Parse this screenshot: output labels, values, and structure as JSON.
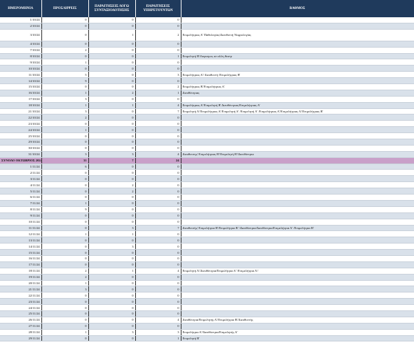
{
  "headers": [
    "ΗΜΕΡΟΜΗΝΙΑ",
    "ΠΡΟΣΛΗΨΕΙΣ",
    "ΠΑΡΑΙΤΗΣΕΙΣ ΛΟΓΩ ΣΥΝΤΑΞΙΟΔΟΤΗΣΗΣ",
    "ΠΑΡΑΙΤΗΣΕΙΣ ΥΠΗΡΕΤΟΥΝΤΩΝ",
    "ΒΑΘΜΟΣ"
  ],
  "rows": [
    {
      "date": "1/10/24",
      "p": "0",
      "s": "0",
      "r": "0",
      "rank": ""
    },
    {
      "date": "2/10/24",
      "p": "0",
      "s": "0",
      "r": "0",
      "rank": ""
    },
    {
      "date": "3/10/24",
      "p": "0",
      "s": "1",
      "r": "2",
      "rank": "Επιμελήτριας Α' Παθολογίας/Διευθυντή Νεφρολογίας",
      "tall": true
    },
    {
      "date": "4/10/24",
      "p": "0",
      "s": "0",
      "r": "0",
      "rank": ""
    },
    {
      "date": "7/10/24",
      "p": "2",
      "s": "0",
      "r": "0",
      "rank": ""
    },
    {
      "date": "8/10/24",
      "p": "0",
      "s": "0",
      "r": "1",
      "rank": "Επιμελητή Β'/διορισμος σε αλλη θεσηr"
    },
    {
      "date": "9/10/24",
      "p": "1",
      "s": "0",
      "r": "0",
      "rank": ""
    },
    {
      "date": "10/10/24",
      "p": "0",
      "s": "0",
      "r": "0",
      "rank": ""
    },
    {
      "date": "11/10/24",
      "p": "5",
      "s": "0",
      "r": "3",
      "rank": "Επιμελήτριας Α'/ Διευθυντή /Επιμελήτριας Β'"
    },
    {
      "date": "14/10/24",
      "p": "9",
      "s": "0",
      "r": "0",
      "rank": ""
    },
    {
      "date": "15/10/24",
      "p": "0",
      "s": "0",
      "r": "2",
      "rank": "Επιμελήτριας Β'/Επιμελήτριας Α'"
    },
    {
      "date": "16/10/24",
      "p": "1",
      "s": "2",
      "r": "1",
      "rank": "Διευθύντριας"
    },
    {
      "date": "17/10/24",
      "p": "3",
      "s": "0",
      "r": "0",
      "rank": ""
    },
    {
      "date": "18/10/24",
      "p": "1",
      "s": "1",
      "r": "4",
      "rank": "Επιμελήτριας Α'/Επιμελητή Β' Διευθύντριας/Επιμελήτριας Α'"
    },
    {
      "date": "21/10/24",
      "p": "3",
      "s": "0",
      "r": "7",
      "rank": "Επιμελητή Α'/Επιμελήτριας Α'/Επιμελητή Α' /Επιμελητή Α' /Επιμελήτριας Α'/Επιμελήτριας Α'/Επιμελήτριας Β'"
    },
    {
      "date": "22/10/24",
      "p": "2",
      "s": "0",
      "r": "0",
      "rank": ""
    },
    {
      "date": "23/10/24",
      "p": "0",
      "s": "0",
      "r": "0",
      "rank": ""
    },
    {
      "date": "24/10/24",
      "p": "1",
      "s": "0",
      "r": "0",
      "rank": ""
    },
    {
      "date": "25/10/24",
      "p": "0",
      "s": "0",
      "r": "0",
      "rank": ""
    },
    {
      "date": "29/10/24",
      "p": "0",
      "s": "0",
      "r": "0",
      "rank": ""
    },
    {
      "date": "30/10/24",
      "p": "0",
      "s": "0",
      "r": "0",
      "rank": ""
    },
    {
      "date": "31/10/24",
      "p": "3",
      "s": "3",
      "r": "4",
      "rank": "Διευθυντης/ Επιμελήτριας Β'/Επιμελητή Β'/Διευθύντρια"
    },
    {
      "date": "ΣΥΝΟΛΟ ΟΚΤΩΒΡΙΟΣ 2024",
      "p": "31",
      "s": "7",
      "r": "24",
      "rank": "",
      "total": true
    },
    {
      "date": "1/11/24",
      "p": "6",
      "s": "0",
      "r": "0",
      "rank": ""
    },
    {
      "date": "2/11/24",
      "p": "0",
      "s": "0",
      "r": "0",
      "rank": ""
    },
    {
      "date": "3/11/24",
      "p": "0",
      "s": "0",
      "r": "0",
      "rank": ""
    },
    {
      "date": "4/11/24",
      "p": "0",
      "s": "2",
      "r": "0",
      "rank": ""
    },
    {
      "date": "5/11/24",
      "p": "0",
      "s": "2",
      "r": "0",
      "rank": ""
    },
    {
      "date": "6/11/24",
      "p": "0",
      "s": "0",
      "r": "0",
      "rank": ""
    },
    {
      "date": "7/11/24",
      "p": "1",
      "s": "0",
      "r": "0",
      "rank": ""
    },
    {
      "date": "8/11/24",
      "p": "9",
      "s": "0",
      "r": "0",
      "rank": ""
    },
    {
      "date": "9/11/24",
      "p": "0",
      "s": "0",
      "r": "0",
      "rank": ""
    },
    {
      "date": "10/11/24",
      "p": "0",
      "s": "0",
      "r": "0",
      "rank": ""
    },
    {
      "date": "11/11/24",
      "p": "0",
      "s": "3",
      "r": "7",
      "rank": "Διευθυντής/ Επιμελήτρια Β'/Επιμελήτρια Β' /Διευθύντρια/Διευθύντρια/Επιμελήτρια Α' /Επιμελήτρια Β'"
    },
    {
      "date": "12/11/24",
      "p": "1",
      "s": "1",
      "r": "0",
      "rank": ""
    },
    {
      "date": "13/11/24",
      "p": "0",
      "s": "0",
      "r": "0",
      "rank": ""
    },
    {
      "date": "14/11/24",
      "p": "0",
      "s": "3",
      "r": "0",
      "rank": ""
    },
    {
      "date": "15/11/24",
      "p": "0",
      "s": "0",
      "r": "0",
      "rank": ""
    },
    {
      "date": "16/11/24",
      "p": "0",
      "s": "0",
      "r": "0",
      "rank": ""
    },
    {
      "date": "17/11/24",
      "p": "0",
      "s": "0",
      "r": "0",
      "rank": ""
    },
    {
      "date": "18/11/24",
      "p": "2",
      "s": "1",
      "r": "4",
      "rank": "Επιμελητή Α'/Διευθύντρια/Επιμελήτρια Α' /Επιμελήτρια Α'/"
    },
    {
      "date": "19/11/24",
      "p": "2",
      "s": "0",
      "r": "0",
      "rank": ""
    },
    {
      "date": "20/11/24",
      "p": "1",
      "s": "0",
      "r": "0",
      "rank": ""
    },
    {
      "date": "21/11/24",
      "p": "3",
      "s": "0",
      "r": "0",
      "rank": ""
    },
    {
      "date": "22/11/24",
      "p": "0",
      "s": "0",
      "r": "0",
      "rank": ""
    },
    {
      "date": "23/11/24",
      "p": "0",
      "s": "0",
      "r": "0",
      "rank": ""
    },
    {
      "date": "24/11/24",
      "p": "0",
      "s": "0",
      "r": "0",
      "rank": ""
    },
    {
      "date": "25/11/24",
      "p": "0",
      "s": "0",
      "r": "0",
      "rank": ""
    },
    {
      "date": "26/11/24",
      "p": "0",
      "s": "0",
      "r": "4",
      "rank": "Διευθύντρια/Επιμελητής Α'/Επιμελήτρια Β'/Διευθυντής"
    },
    {
      "date": "27/11/24",
      "p": "0",
      "s": "0",
      "r": "0",
      "rank": ""
    },
    {
      "date": "28/11/24",
      "p": "1",
      "s": "3",
      "r": "3",
      "rank": "Επιμελήτρια Α'/Διευθύντρια/Επιμελητής Α'"
    },
    {
      "date": "29/11/24",
      "p": "0",
      "s": "0",
      "r": "1",
      "rank": "Επιμελητή Β'"
    }
  ]
}
